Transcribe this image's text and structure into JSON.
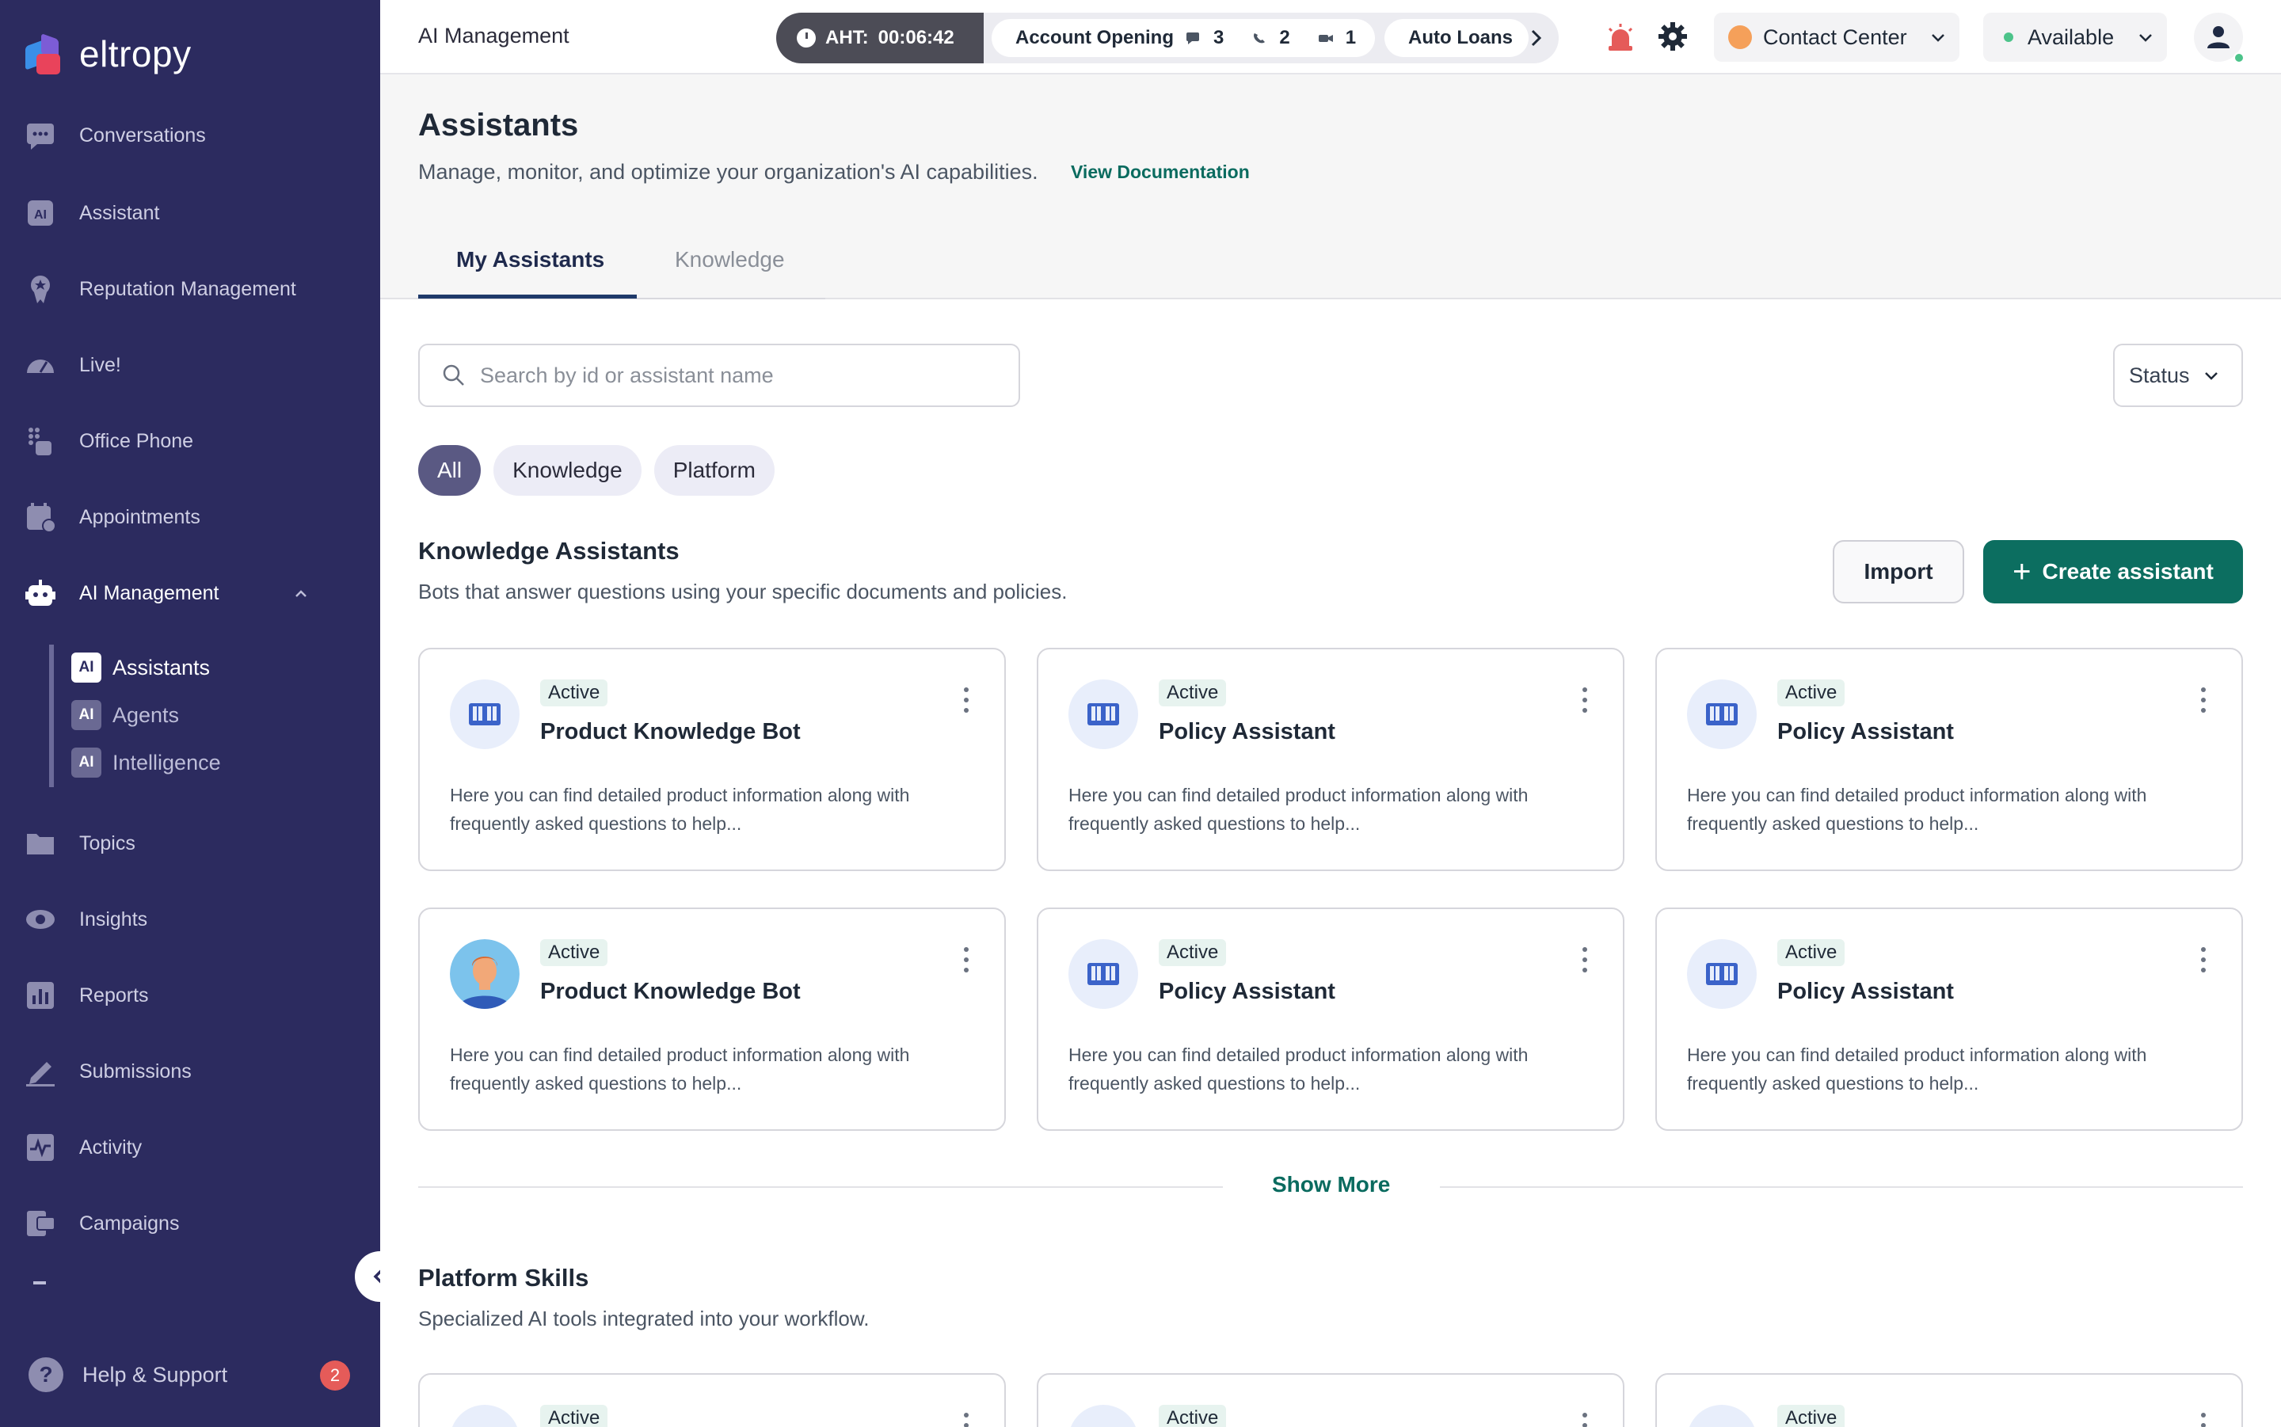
{
  "brand": {
    "name": "eltropy"
  },
  "sidebar": {
    "items": [
      {
        "label": "Conversations",
        "icon": "chat-icon"
      },
      {
        "label": "Assistant",
        "icon": "ai-icon"
      },
      {
        "label": "Reputation Management",
        "icon": "award-icon"
      },
      {
        "label": "Live!",
        "icon": "gauge-icon"
      },
      {
        "label": "Office Phone",
        "icon": "dialpad-icon"
      },
      {
        "label": "Appointments",
        "icon": "calendar-icon"
      },
      {
        "label": "AI Management",
        "icon": "robot-icon"
      },
      {
        "label": "Topics",
        "icon": "folder-icon"
      },
      {
        "label": "Insights",
        "icon": "eye-icon"
      },
      {
        "label": "Reports",
        "icon": "bar-chart-icon"
      },
      {
        "label": "Submissions",
        "icon": "pen-icon"
      },
      {
        "label": "Activity",
        "icon": "activity-icon"
      },
      {
        "label": "Campaigns",
        "icon": "campaign-icon"
      }
    ],
    "sub_items": [
      {
        "badge": "AI",
        "label": "Assistants"
      },
      {
        "badge": "AI",
        "label": "Agents"
      },
      {
        "badge": "AI",
        "label": "Intelligence"
      }
    ],
    "help_label": "Help & Support",
    "help_badge": "2"
  },
  "topbar": {
    "title": "AI Management",
    "aht_label": "AHT:",
    "aht_value": "00:06:42",
    "queue": {
      "name": "Account Opening",
      "chat_count": "3",
      "call_count": "2",
      "video_count": "1",
      "next_queue": "Auto Loans"
    },
    "contact_center": "Contact Center",
    "availability": "Available"
  },
  "page": {
    "title": "Assistants",
    "description": "Manage, monitor, and optimize your organization's AI capabilities.",
    "doc_link": "View Documentation",
    "tabs": [
      "My Assistants",
      "Knowledge"
    ]
  },
  "filters": {
    "search_placeholder": "Search by id or assistant name",
    "status_label": "Status",
    "chips": [
      "All",
      "Knowledge",
      "Platform"
    ]
  },
  "knowledge_section": {
    "title": "Knowledge Assistants",
    "description": "Bots that answer questions using your specific documents and policies.",
    "import_label": "Import",
    "create_label": "Create assistant",
    "cards": [
      {
        "status": "Active",
        "title": "Product Knowledge Bot",
        "desc": "Here you can find detailed product information along with frequently asked questions to help...",
        "avatar": "book-icon"
      },
      {
        "status": "Active",
        "title": "Policy Assistant",
        "desc": "Here you can find detailed product information along with frequently asked questions to help...",
        "avatar": "book-icon"
      },
      {
        "status": "Active",
        "title": "Policy Assistant",
        "desc": "Here you can find detailed product information along with frequently asked questions to help...",
        "avatar": "book-icon"
      },
      {
        "status": "Active",
        "title": "Product Knowledge Bot",
        "desc": "Here you can find detailed product information along with frequently asked questions to help...",
        "avatar": "person-avatar"
      },
      {
        "status": "Active",
        "title": "Policy Assistant",
        "desc": "Here you can find detailed product information along with frequently asked questions to help...",
        "avatar": "book-icon"
      },
      {
        "status": "Active",
        "title": "Policy Assistant",
        "desc": "Here you can find detailed product information along with frequently asked questions to help...",
        "avatar": "book-icon"
      }
    ],
    "show_more": "Show More"
  },
  "platform_section": {
    "title": "Platform Skills",
    "description": "Specialized AI tools integrated into your workflow.",
    "cards": [
      {
        "status": "Active"
      },
      {
        "status": "Active"
      },
      {
        "status": "Active"
      }
    ]
  },
  "colors": {
    "sidebar_bg": "#2c2b5f",
    "accent_green": "#0c6e60",
    "link_green": "#0a6b5f",
    "active_chip": "#5a5983",
    "badge_red": "#e55b59",
    "status_green": "#4cc38a"
  }
}
